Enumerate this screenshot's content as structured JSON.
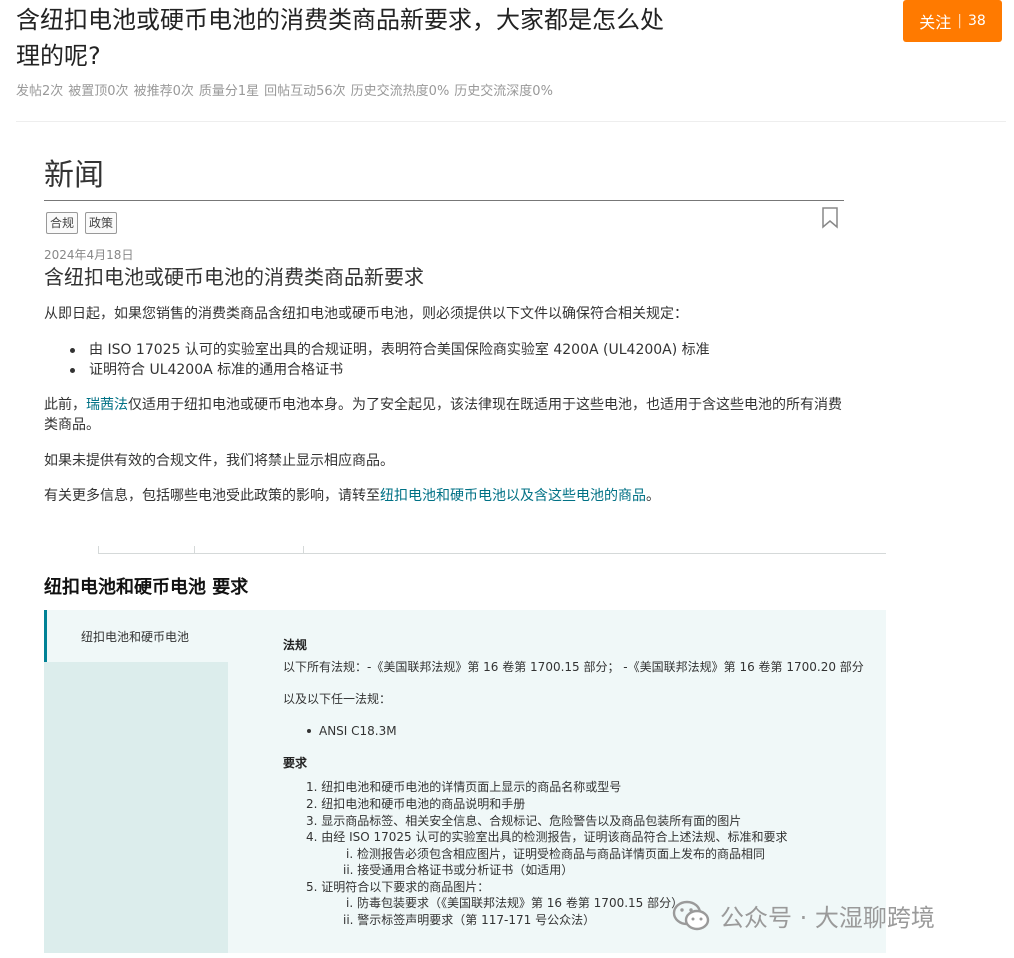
{
  "post": {
    "title": "含纽扣电池或硬币电池的消费类商品新要求，大家都是怎么处理的呢?",
    "follow_label": "关注",
    "follow_sep": "|",
    "follow_count": "38",
    "stats": [
      "发帖2次",
      "被置顶0次",
      "被推荐0次",
      "质量分1星",
      "回帖互动56次",
      "历史交流热度0%",
      "历史交流深度0%"
    ]
  },
  "article": {
    "section_heading": "新闻",
    "tags": [
      "合规",
      "政策"
    ],
    "date": "2024年4月18日",
    "title": "含纽扣电池或硬币电池的消费类商品新要求",
    "intro": "从即日起，如果您销售的消费类商品含纽扣电池或硬币电池，则必须提供以下文件以确保符合相关规定：",
    "bullets": [
      "由 ISO 17025 认可的实验室出具的合规证明，表明符合美国保险商实验室 4200A (UL4200A) 标准",
      "证明符合 UL4200A 标准的通用合格证书"
    ],
    "para_prev_1": "此前，",
    "para_prev_link": "瑞茜法",
    "para_prev_2": "仅适用于纽扣电池或硬币电池本身。为了安全起见，该法律现在既适用于这些电池，也适用于含这些电池的所有消费类商品。",
    "para_ifnot": "如果未提供有效的合规文件，我们将禁止显示相应商品。",
    "para_more_1": "有关更多信息，包括哪些电池受此政策的影响，请转至",
    "para_more_link": "纽扣电池和硬币电池以及含这些电池的商品",
    "para_more_2": "。"
  },
  "requirements": {
    "heading": "纽扣电池和硬币电池 要求",
    "side_item": "纽扣电池和硬币电池",
    "law_heading": "法规",
    "law_text": "以下所有法规：-《美国联邦法规》第 16 卷第 1700.15 部分；  -《美国联邦法规》第 16 卷第 1700.20 部分",
    "law_any": "以及以下任一法规：",
    "law_bullet": "ANSI C18.3M",
    "req_heading": "要求",
    "items": [
      "1. 纽扣电池和硬币电池的详情页面上显示的商品名称或型号",
      "2. 纽扣电池和硬币电池的商品说明和手册",
      "3. 显示商品标签、相关安全信息、合规标记、危险警告以及商品包装所有面的图片",
      "4. 由经 ISO 17025 认可的实验室出具的检测报告，证明该商品符合上述法规、标准和要求",
      "i. 检测报告必须包含相应图片，证明受检商品与商品详情页面上发布的商品相同",
      "ii. 接受通用合格证书或分析证书（如适用）",
      "5. 证明符合以下要求的商品图片：",
      "i. 防毒包装要求（《美国联邦法规》第 16 卷第 1700.15 部分）",
      "ii. 警示标签声明要求（第 117-171 号公众法）"
    ]
  },
  "watermark": "公众号 · 大湿聊跨境",
  "icons": {
    "bookmark": "bookmark-icon",
    "wechat": "wechat-icon"
  },
  "colors": {
    "accent": "#ff7a00",
    "link": "#007185",
    "panel_bg": "#f0f8f8",
    "side_bg": "#dcedec"
  }
}
